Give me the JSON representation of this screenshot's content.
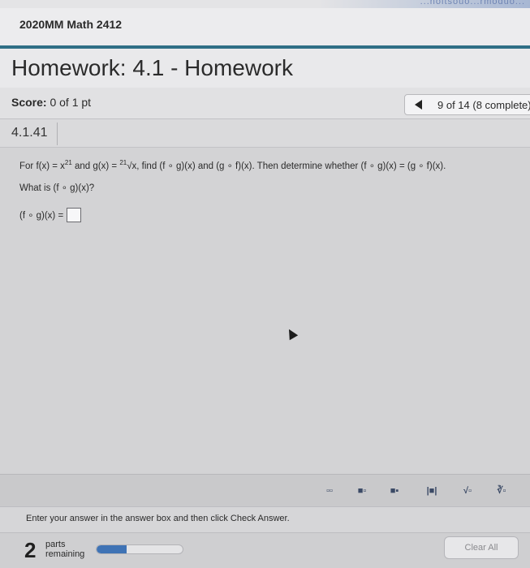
{
  "top_strip": {
    "text": "...noitsouo...rmoduo..."
  },
  "course": {
    "title": "2020MM Math 2412"
  },
  "homework": {
    "title": "Homework: 4.1 - Homework"
  },
  "score": {
    "label": "Score:",
    "value": "0 of 1 pt"
  },
  "navigation": {
    "position_text": "9 of 14 (8 complete)"
  },
  "question": {
    "number": "4.1.41",
    "text_a": "For f(x) = x",
    "exp1": "21",
    "text_b": " and g(x) = ",
    "exp2": "21",
    "text_c": "√x, find (f ∘ g)(x) and (g ∘ f)(x). Then determine whether (f ∘ g)(x) = (g ∘ f)(x).",
    "sub_prompt": "What is (f ∘ g)(x)?",
    "answer_label": "(f ∘ g)(x) ="
  },
  "toolbar": {
    "tools": [
      {
        "name": "fraction-tool-icon",
        "glyph": "▫▫"
      },
      {
        "name": "mixed-number-tool-icon",
        "glyph": "■▫"
      },
      {
        "name": "exponent-tool-icon",
        "glyph": "■▪"
      },
      {
        "name": "absolute-value-tool-icon",
        "glyph": "|■|"
      },
      {
        "name": "square-root-tool-icon",
        "glyph": "√▫"
      },
      {
        "name": "nth-root-tool-icon",
        "glyph": "∛▫"
      }
    ]
  },
  "instructions": {
    "text": "Enter your answer in the answer box and then click Check Answer."
  },
  "footer": {
    "parts_count": "2",
    "parts_label_line1": "parts",
    "parts_label_line2": "remaining",
    "progress": 0.35,
    "clear_all_label": "Clear All"
  },
  "colors": {
    "accent_teal": "#2f6f86",
    "progress_blue": "#3f73b5"
  }
}
